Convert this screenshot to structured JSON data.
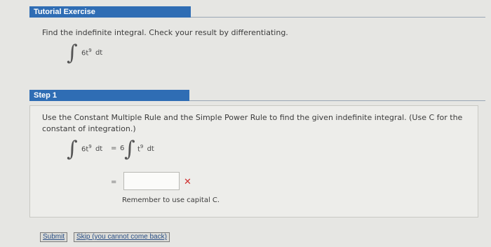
{
  "header": {
    "title": "Tutorial Exercise"
  },
  "problem": {
    "prompt": "Find the indefinite integral. Check your result by differentiating.",
    "integrand": "6t",
    "exponent": "9",
    "differential": "dt"
  },
  "step": {
    "title": "Step 1",
    "instructions": "Use the Constant Multiple Rule and the Simple Power Rule to find the given indefinite integral. (Use C for the constant of integration.)",
    "lhs_integrand": "6t",
    "lhs_exponent": "9",
    "lhs_differential": "dt",
    "equals": "=",
    "constant": "6",
    "rhs_integrand": "t",
    "rhs_exponent": "9",
    "rhs_differential": "dt",
    "answer_equals": "=",
    "answer_value": "",
    "feedback_icon": "x-mark",
    "feedback_text": "Remember to use capital C."
  },
  "buttons": {
    "submit": "Submit",
    "skip": "Skip (you cannot come back)"
  },
  "colors": {
    "accent": "#2f6db4",
    "error": "#cf2e2e"
  }
}
